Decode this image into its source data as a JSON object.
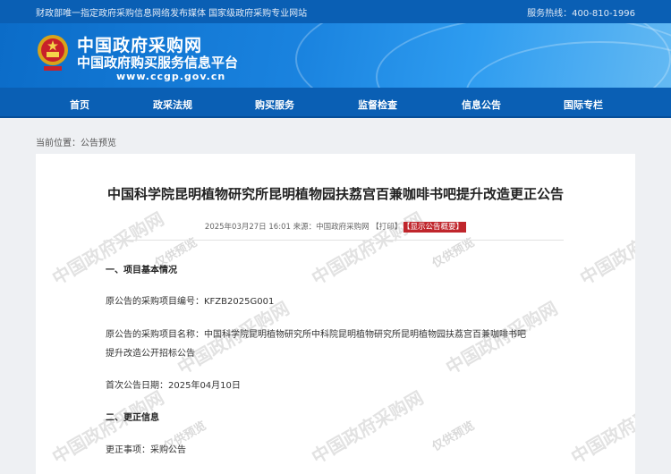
{
  "topbar": {
    "left_text": "财政部唯一指定政府采购信息网络发布媒体 国家级政府采购专业网站",
    "hotline": "服务热线：400-810-1996"
  },
  "brand": {
    "title": "中国政府采购网",
    "subtitle": "中国政府购买服务信息平台",
    "url": "www.ccgp.gov.cn"
  },
  "nav": {
    "items": [
      "首页",
      "政采法规",
      "购买服务",
      "监督检查",
      "信息公告",
      "国际专栏"
    ]
  },
  "breadcrumb": {
    "label": "当前位置：",
    "current": "公告预览"
  },
  "article": {
    "title": "中国科学院昆明植物研究所昆明植物园扶荔宫百兼咖啡书吧提升改造更正公告",
    "meta_text": "2025年03月27日 16:01 来源：中国政府采购网 【打印】",
    "summary_tag": "【显示公告概要】",
    "lines": [
      "一、项目基本情况",
      "原公告的采购项目编号：KFZB2025G001",
      "原公告的采购项目名称：中国科学院昆明植物研究所中科院昆明植物研究所昆明植物园扶荔宫百兼咖啡书吧",
      "提升改造公开招标公告",
      "首次公告日期：2025年04月10日",
      "二、更正信息",
      "更正事项：采购公告"
    ]
  },
  "watermark": {
    "main": "中国政府采购网",
    "preview": "仅供预览"
  },
  "colors": {
    "nav_blue": "#0a5fb4",
    "tag_red": "#c0262c"
  }
}
